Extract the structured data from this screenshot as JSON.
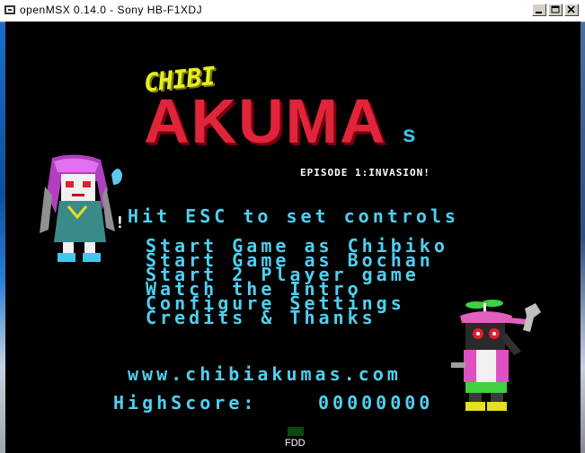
{
  "window": {
    "title": "openMSX 0.14.0 - Sony HB-F1XDJ",
    "controls": [
      "minimize-icon",
      "maximize-icon",
      "close-icon"
    ]
  },
  "game": {
    "logo": {
      "chibi": "CHIBI",
      "akuma": "AKUMA",
      "s": "s"
    },
    "episode": "EPISODE 1:INVASION!",
    "hint": "Hit ESC to set controls",
    "cursor": "!",
    "menu": [
      "Start Game as Chibiko",
      "Start Game as Bochan",
      "Start 2 Player game",
      "Watch the Intro",
      "Configure Settings",
      "Credits & Thanks"
    ],
    "website": "www.chibiakumas.com",
    "highscore_label": "HighScore:",
    "highscore_value": "00000000"
  },
  "status": {
    "fdd": "FDD"
  },
  "colors": {
    "cyan": "#4fd0f0",
    "logo_red": "#e0243a",
    "logo_yellow": "#e6f020",
    "fdd_led": "#0a4a10"
  }
}
